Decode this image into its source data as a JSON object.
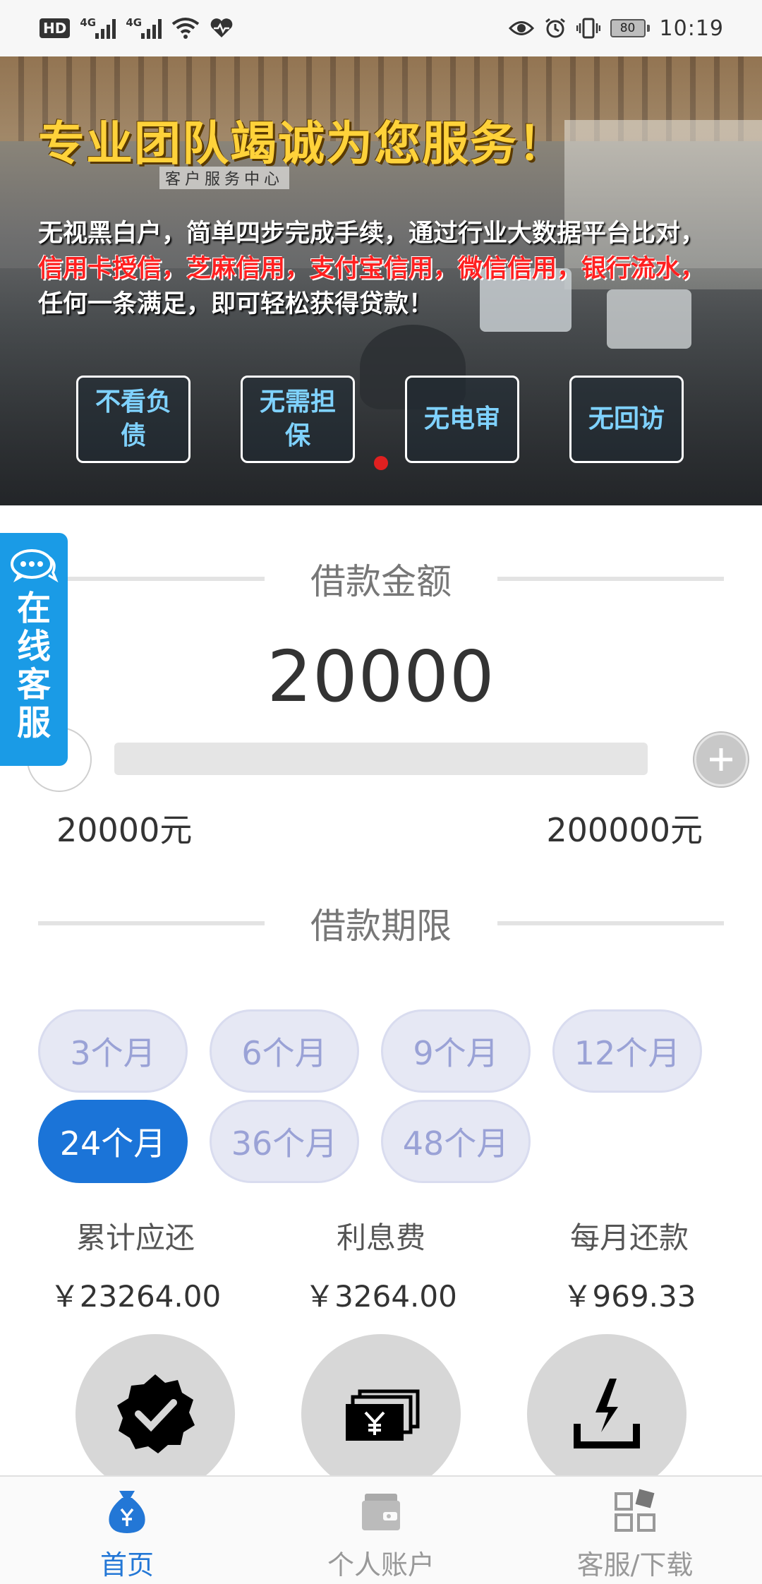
{
  "status_bar": {
    "hd": "HD",
    "sim1_label": "4G",
    "sim2_label": "4G",
    "battery": "80",
    "time": "10:19"
  },
  "banner": {
    "title": "专业团队竭诚为您服务！",
    "subtitle": "客户服务中心",
    "line1": "无视黑白户，简单四步完成手续，通过行业大数据平台比对，",
    "line2": "信用卡授信，芝麻信用，支付宝信用，微信信用，银行流水，",
    "line3": "任何一条满足，即可轻松获得贷款！",
    "boxes": [
      "不看负债",
      "无需担保",
      "无电审",
      "无回访"
    ]
  },
  "service_float": {
    "label": "在线客服",
    "icon": "chat-bubble-icon"
  },
  "loan_amount": {
    "title": "借款金额",
    "value": "20000",
    "min_label": "20000元",
    "max_label": "200000元",
    "slider_fraction": 0.0
  },
  "loan_term": {
    "title": "借款期限",
    "options": [
      "3个月",
      "6个月",
      "9个月",
      "12个月",
      "24个月",
      "36个月",
      "48个月"
    ],
    "selected": "24个月"
  },
  "summary": {
    "total_label": "累计应还",
    "total_value": "￥23264.00",
    "interest_label": "利息费",
    "interest_value": "￥3264.00",
    "monthly_label": "每月还款",
    "monthly_value": "￥969.33"
  },
  "features": [
    "verified-badge-icon",
    "cash-yuan-icon",
    "lightning-tray-icon"
  ],
  "tab_bar": {
    "items": [
      {
        "label": "首页",
        "icon": "money-bag-icon",
        "active": true
      },
      {
        "label": "个人账户",
        "icon": "wallet-icon",
        "active": false
      },
      {
        "label": "客服/下载",
        "icon": "apps-grid-icon",
        "active": false
      }
    ]
  },
  "colors": {
    "accent": "#1b74d8",
    "service_blue": "#1a9be6",
    "term_inactive_bg": "#e6e8f4",
    "term_inactive_text": "#9aa2d6",
    "banner_title": "#ffd23a",
    "banner_red": "#ff2020"
  }
}
